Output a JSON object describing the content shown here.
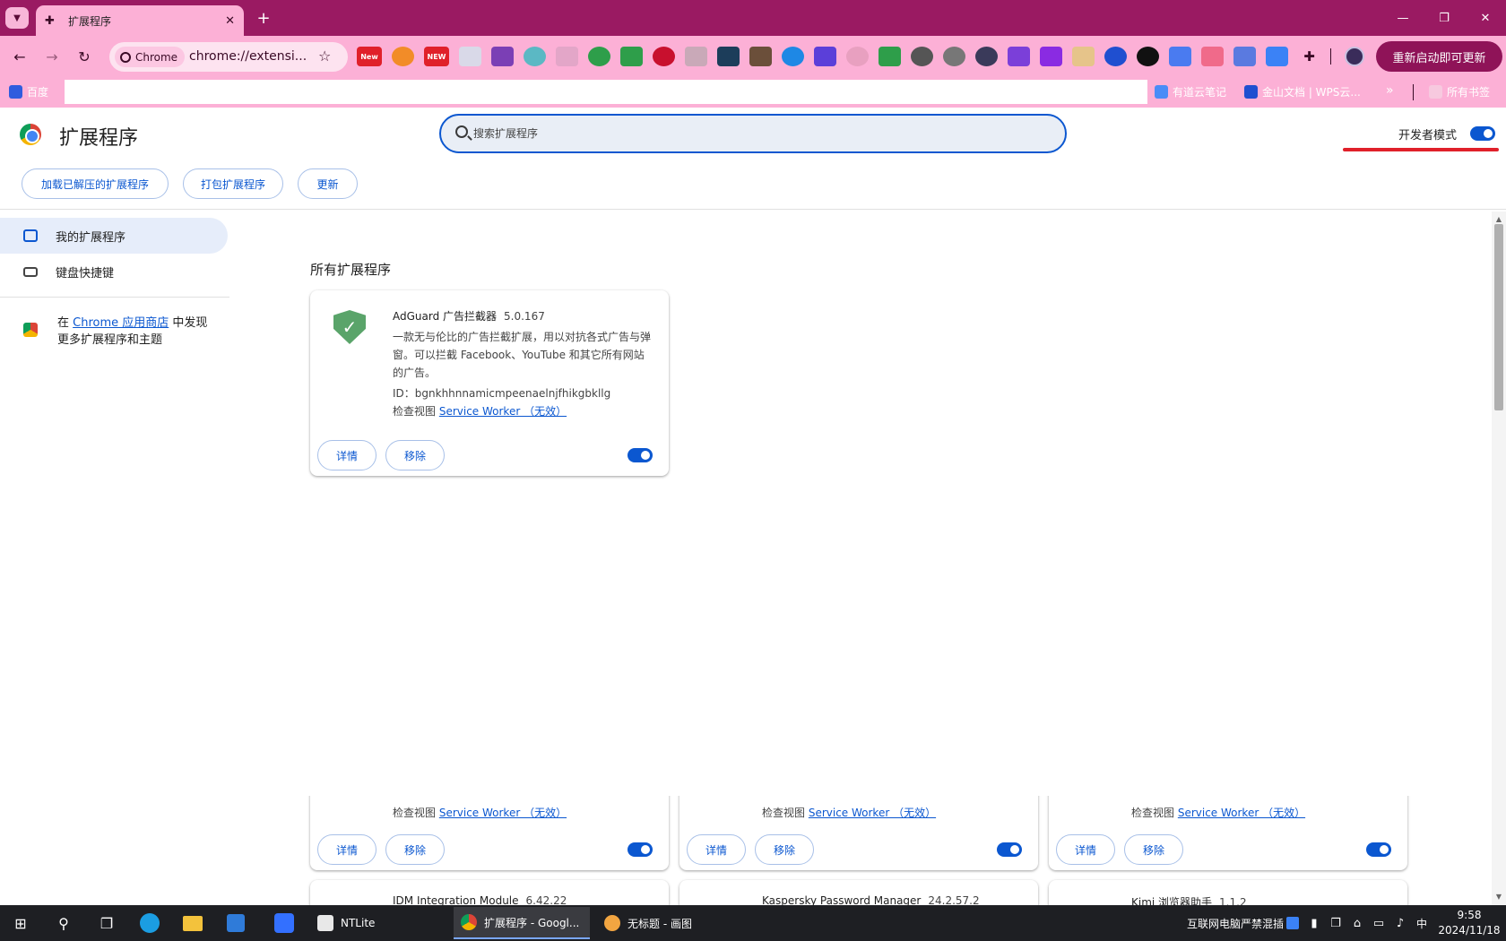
{
  "browser": {
    "tab": {
      "title": "扩展程序"
    },
    "window_controls": {
      "minimize": "—",
      "restore": "❐",
      "close": "✕"
    },
    "omnibox": {
      "chip": "Chrome",
      "url": "chrome://extensi..."
    },
    "relaunch_label": "重新启动即可更新",
    "new_badge_1": "New",
    "new_badge_2": "NEW",
    "bookmarks": {
      "baidu": "百度",
      "youdao": "有道云笔记",
      "wps": "金山文档 | WPS云...",
      "all": "所有书签"
    }
  },
  "extensions_page": {
    "title": "扩展程序",
    "search_placeholder": "搜索扩展程序",
    "developer_mode_label": "开发者模式",
    "developer_mode_on": true,
    "actions": {
      "load_unpacked": "加载已解压的扩展程序",
      "pack": "打包扩展程序",
      "update": "更新"
    },
    "sidebar": {
      "my_extensions": "我的扩展程序",
      "keyboard_shortcuts": "键盘快捷键",
      "store_prefix": "在 ",
      "store_link": "Chrome 应用商店",
      "store_suffix": " 中发现更多扩展程序和主题"
    },
    "section_title": "所有扩展程序",
    "card": {
      "name": "AdGuard 广告拦截器",
      "version": "5.0.167",
      "description": "一款无与伦比的广告拦截扩展，用以对抗各式广告与弹窗。可以拦截 Facebook、YouTube 和其它所有网站的广告。",
      "id_line": "ID：bgnkhhnnamicmpeenaelnjfhikgbkllg",
      "inspect_label": "检查视图 ",
      "service_worker": "Service Worker （无效）",
      "details": "详情",
      "remove": "移除",
      "enabled": true
    },
    "lower_cards": [
      {
        "inspect_label": "检查视图 ",
        "service_worker": "Service Worker （无效）",
        "details": "详情",
        "remove": "移除",
        "next_name": "IDM Integration Module",
        "next_version": "6.42.22"
      },
      {
        "inspect_label": "检查视图 ",
        "service_worker": "Service Worker （无效）",
        "details": "详情",
        "remove": "移除",
        "next_name": "Kaspersky Password Manager",
        "next_version": "24.2.57.2"
      },
      {
        "inspect_label": "检查视图 ",
        "service_worker": "Service Worker （无效）",
        "details": "详情",
        "remove": "移除",
        "next_name": "Kimi 浏览器助手",
        "next_version": "1.1.2"
      }
    ]
  },
  "taskbar": {
    "apps": [
      {
        "label": "NTLite"
      },
      {
        "label": "扩展程序 - Googl..."
      },
      {
        "label": "无标题 - 画图"
      }
    ],
    "tray_text": "互联网电脑严禁混插",
    "ime": "中",
    "time": "9:58",
    "date": "2024/11/18"
  },
  "colors": {
    "titlebar": "#9a1a62",
    "toolbar": "#fcb0d6",
    "accent": "#0b57d0"
  }
}
